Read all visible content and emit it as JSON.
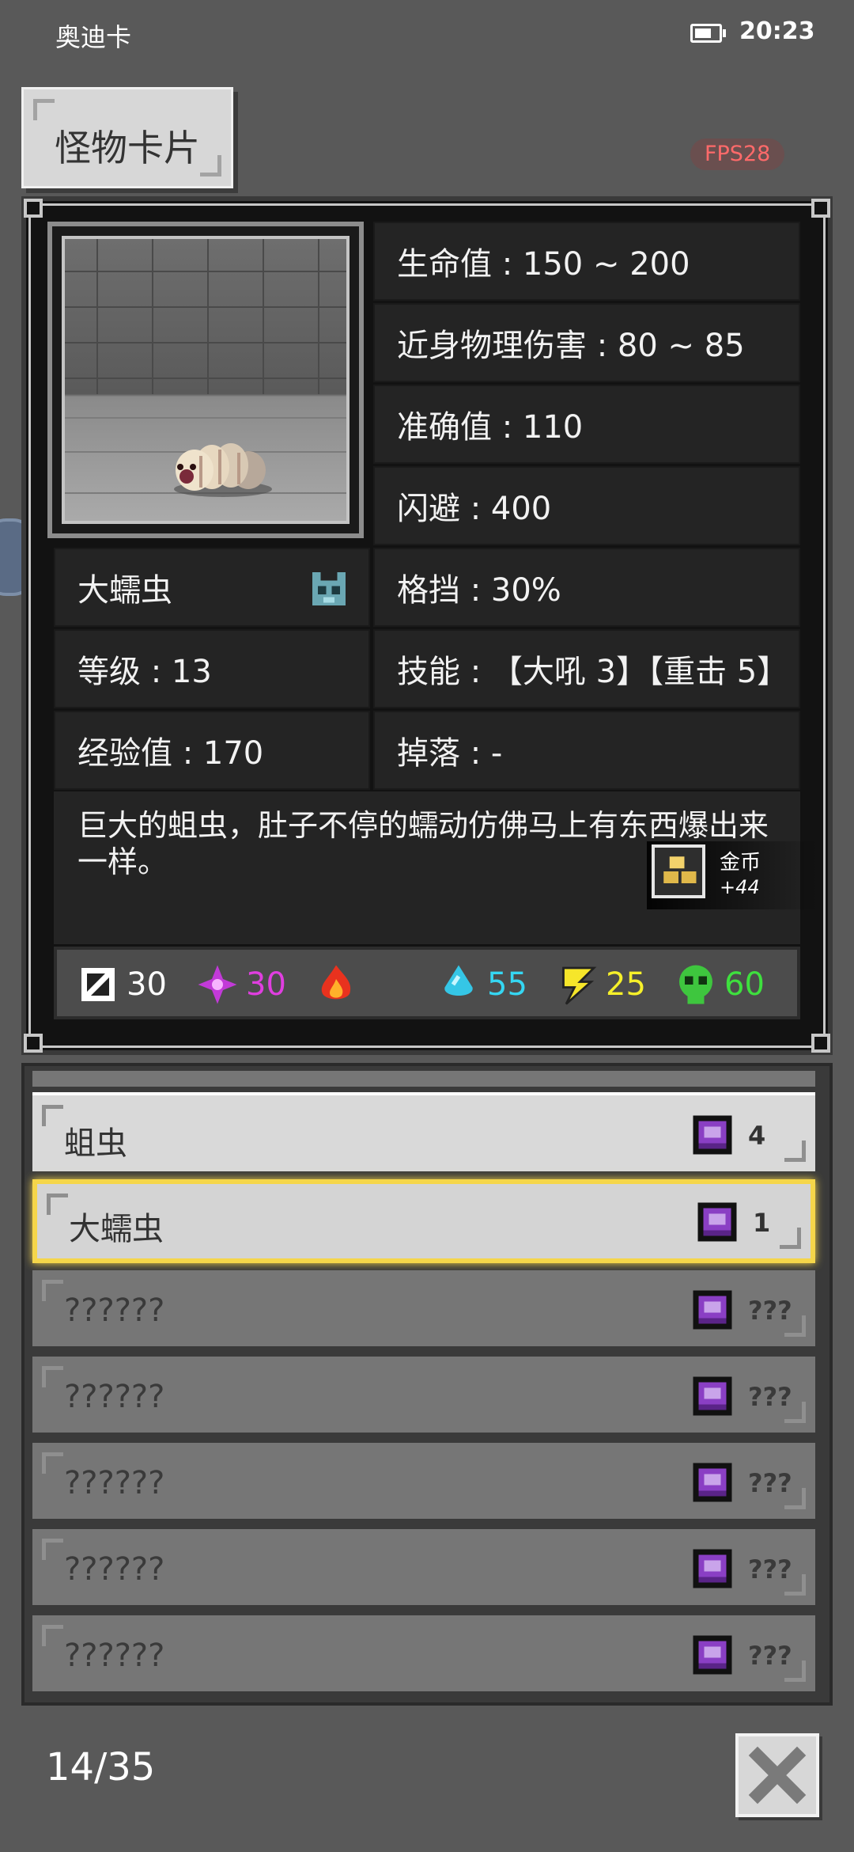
{
  "status_bar": {
    "app_name": "奥迪卡",
    "time": "20:23"
  },
  "title": "怪物卡片",
  "fps": "FPS28",
  "monster": {
    "name": "大蠕虫",
    "level": "等级 : 13",
    "exp": "经验值 : 170",
    "stats": [
      "生命值 : 150 ~ 200",
      "近身物理伤害 : 80 ~ 85",
      "准确值 : 110",
      "闪避 : 400",
      "格挡 : 30%",
      "技能 : 【大吼 3】【重击 5】",
      "掉落 : -"
    ],
    "description": "巨大的蛆虫，肚子不停的蠕动仿佛马上有东西爆出来一样。",
    "drop": {
      "name": "金币",
      "count": "+44",
      "icon": "gold-coins-icon"
    }
  },
  "resistances": [
    {
      "icon": "physical-icon",
      "value": "30",
      "color": "#ffffff"
    },
    {
      "icon": "magic-icon",
      "value": "30",
      "color": "#e03ee0"
    },
    {
      "icon": "fire-icon",
      "value": "",
      "color": "#ff4a2a"
    },
    {
      "icon": "water-icon",
      "value": "55",
      "color": "#35d6f2"
    },
    {
      "icon": "lightning-icon",
      "value": "25",
      "color": "#f6f02a"
    },
    {
      "icon": "poison-icon",
      "value": "60",
      "color": "#3ee03e"
    }
  ],
  "list": [
    {
      "name": "蛆虫",
      "count": "4",
      "state": "light"
    },
    {
      "name": "大蠕虫",
      "count": "1",
      "state": "selected"
    },
    {
      "name": "??????",
      "count": "???",
      "state": "dark"
    },
    {
      "name": "??????",
      "count": "???",
      "state": "dark"
    },
    {
      "name": "??????",
      "count": "???",
      "state": "dark"
    },
    {
      "name": "??????",
      "count": "???",
      "state": "dark"
    },
    {
      "name": "??????",
      "count": "???",
      "state": "dark"
    }
  ],
  "page_counter": "14/35"
}
